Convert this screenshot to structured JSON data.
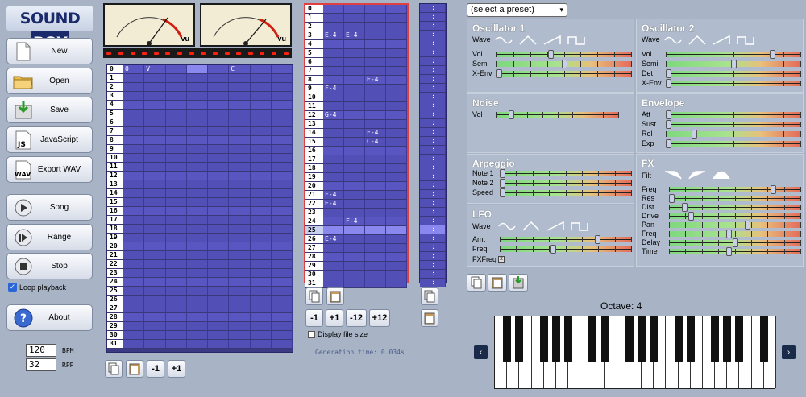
{
  "app": {
    "logo": "SOUND",
    "logo_b": "BOX"
  },
  "toolbar": {
    "new": "New",
    "open": "Open",
    "save": "Save",
    "javascript": "JavaScript",
    "export_wav": "Export WAV",
    "song": "Song",
    "range": "Range",
    "stop": "Stop",
    "loop": "Loop playback",
    "about": "About"
  },
  "song": {
    "bpm": "120",
    "bpm_label": "BPM",
    "rpp": "32",
    "rpp_label": "RPP",
    "header_cells": [
      "0",
      "V",
      "",
      "",
      "",
      "C",
      "",
      "",
      "",
      ""
    ],
    "rows": 32
  },
  "pattern": {
    "rows": 32,
    "notes": {
      "3": [
        "E-4",
        "E-4"
      ],
      "8": [
        "",
        "",
        "E-4"
      ],
      "9": [
        "F-4"
      ],
      "12": [
        "G-4"
      ],
      "14": [
        "",
        "",
        "F-4"
      ],
      "15": [
        "",
        "",
        "C-4"
      ],
      "21": [
        "F-4"
      ],
      "22": [
        "E-4"
      ],
      "24": [
        "",
        "F-4"
      ],
      "26": [
        "E-4"
      ]
    },
    "selected_row": 25,
    "buttons": [
      "-1",
      "+1",
      "-12",
      "+12"
    ],
    "display_file_size": "Display file size",
    "generation_time": "Generation time: 0.034s"
  },
  "instrument": {
    "preset": "(select a preset)",
    "osc1": {
      "title": "Oscillator 1",
      "wave": "Wave",
      "sliders": [
        {
          "label": "Vol",
          "value": 0.4
        },
        {
          "label": "Semi",
          "value": 0.5
        },
        {
          "label": "X-Env",
          "value": 0.0
        }
      ]
    },
    "osc2": {
      "title": "Oscillator 2",
      "wave": "Wave",
      "sliders": [
        {
          "label": "Vol",
          "value": 0.8
        },
        {
          "label": "Semi",
          "value": 0.5
        },
        {
          "label": "Det",
          "value": 0.0
        },
        {
          "label": "X-Env",
          "value": 0.0
        }
      ]
    },
    "noise": {
      "title": "Noise",
      "sliders": [
        {
          "label": "Vol",
          "value": 0.1
        }
      ]
    },
    "envelope": {
      "title": "Envelope",
      "sliders": [
        {
          "label": "Att",
          "value": 0.0
        },
        {
          "label": "Sust",
          "value": 0.0
        },
        {
          "label": "Rel",
          "value": 0.2
        },
        {
          "label": "Exp",
          "value": 0.0
        }
      ]
    },
    "arpeggio": {
      "title": "Arpeggio",
      "sliders": [
        {
          "label": "Note 1",
          "value": 0.0
        },
        {
          "label": "Note 2",
          "value": 0.0
        },
        {
          "label": "Speed",
          "value": 0.0
        }
      ]
    },
    "fx": {
      "title": "FX",
      "filt": "Filt",
      "sliders": [
        {
          "label": "Freq",
          "value": 0.8
        },
        {
          "label": "Res",
          "value": 0.0
        },
        {
          "label": "Dist",
          "value": 0.1
        },
        {
          "label": "Drive",
          "value": 0.15
        },
        {
          "label": "Pan",
          "value": 0.6
        },
        {
          "label": "Freq",
          "value": 0.45
        },
        {
          "label": "Delay",
          "value": 0.5
        },
        {
          "label": "Time",
          "value": 0.45
        }
      ]
    },
    "lfo": {
      "title": "LFO",
      "wave": "Wave",
      "sliders": [
        {
          "label": "Amt",
          "value": 0.75
        },
        {
          "label": "Freq",
          "value": 0.4
        }
      ],
      "fxfreq": "FXFreq"
    },
    "octave": "Octave: 4"
  },
  "colors": {
    "accent": "#524fb6",
    "grid_dark": "#3c3a82",
    "panel": "#b0bccd"
  }
}
